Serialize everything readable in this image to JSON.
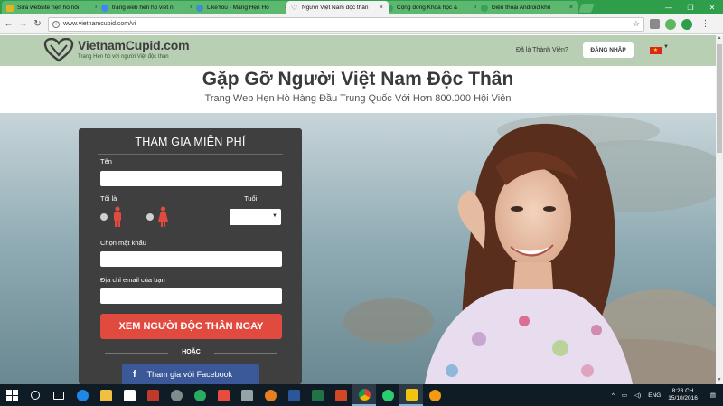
{
  "browser": {
    "tabs": [
      {
        "title": "Sửa website hẹn hò nổi",
        "favicon_color": "#e6b422"
      },
      {
        "title": "trang web hen ho viet n",
        "favicon_color": "#4285f4"
      },
      {
        "title": "LikeYou - Mạng Hẹn Hò",
        "favicon_color": "#3d8fd1"
      },
      {
        "title": "Người Việt Nam độc thân",
        "favicon_color": "#555555"
      },
      {
        "title": "Cộng đồng Khoa học &",
        "favicon_color": "#3aa15a"
      },
      {
        "title": "Điện thoại Android khô",
        "favicon_color": "#3aa15a"
      }
    ],
    "url": "www.vietnamcupid.com/vi",
    "nav_icons": [
      "back-arrow-icon",
      "forward-arrow-icon",
      "reload-icon"
    ]
  },
  "site": {
    "logo_name": "VietnamCupid.com",
    "logo_tagline": "Trang Hẹn hò với người Việt độc thân",
    "member_prompt": "Đã là Thành Viên?",
    "login_label": "ĐĂNG NHẬP",
    "headline": "Gặp Gỡ Người Việt Nam Độc Thân",
    "subheadline": "Trang Web Hẹn Hò Hàng Đầu Trung Quốc Với Hơn 800.000 Hội Viên"
  },
  "signup": {
    "title": "THAM GIA MIỄN PHÍ",
    "name_label": "Tên",
    "iam_label": "Tôi là",
    "age_label": "Tuổi",
    "password_label": "Chọn mật khẩu",
    "email_label": "Địa chỉ email của bạn",
    "submit_label": "XEM NGƯỜI ĐỘC THÂN NGAY",
    "or_label": "HOẶC",
    "facebook_label": "Tham gia với Facebook",
    "facebook_glyph": "f"
  },
  "colors": {
    "chrome_green": "#2e9e4a",
    "header_bg": "#b9cfb3",
    "panel_bg": "#3f3f3f",
    "cta_red": "#e14a3f",
    "facebook_blue": "#3b5998"
  },
  "taskbar": {
    "language": "ENG",
    "time": "8:28 CH",
    "date": "15/10/2016"
  }
}
